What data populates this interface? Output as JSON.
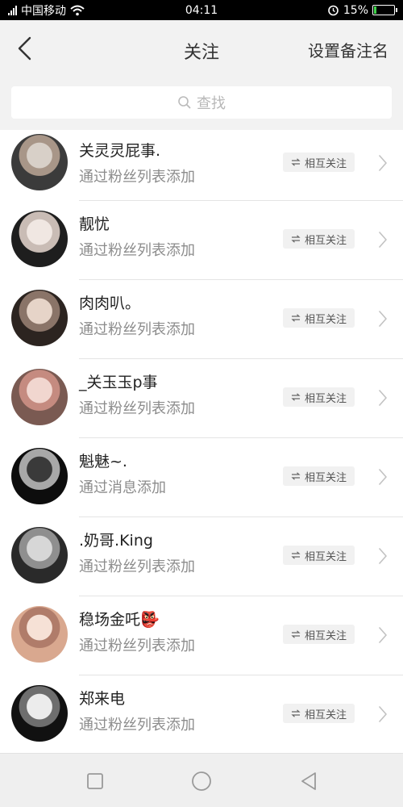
{
  "status": {
    "carrier": "中国移动",
    "time": "04:11",
    "battery": "15%",
    "battery_level": 0.15
  },
  "header": {
    "title": "关注",
    "remark_label": "设置备注名"
  },
  "search": {
    "placeholder": "查找"
  },
  "follows": [
    {
      "name": "关灵灵屁事.",
      "source": "通过粉丝列表添加",
      "badge": "相互关注"
    },
    {
      "name": "靓忧",
      "source": "通过粉丝列表添加",
      "badge": "相互关注"
    },
    {
      "name": "肉肉叭。",
      "source": "通过粉丝列表添加",
      "badge": "相互关注"
    },
    {
      "name": "_关玉玉p事",
      "source": "通过粉丝列表添加",
      "badge": "相互关注"
    },
    {
      "name": "魁魅~.",
      "source": "通过消息添加",
      "badge": "相互关注"
    },
    {
      "name": ".奶哥.King",
      "source": "通过粉丝列表添加",
      "badge": "相互关注"
    },
    {
      "name": "稳场金吒👺",
      "source": "通过粉丝列表添加",
      "badge": "相互关注"
    },
    {
      "name": "郑来电",
      "source": "通过粉丝列表添加",
      "badge": "相互关注"
    }
  ],
  "colors": {
    "badge_bg": "#f1f1f1",
    "battery_green": "#3fd34a"
  }
}
